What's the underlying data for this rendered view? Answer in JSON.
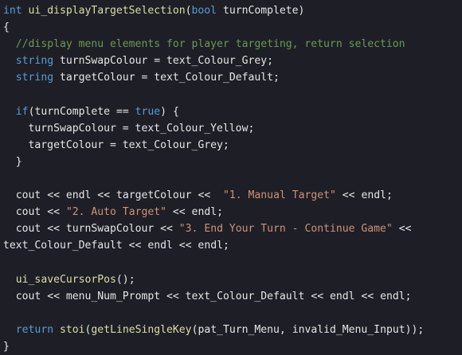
{
  "theme": {
    "background": "#1e1f26",
    "colors": {
      "kw": "#569cd6",
      "fn": "#dcdcaa",
      "id": "#e6e6e6",
      "cm": "#6a9955",
      "st": "#ce9178",
      "op": "#e6e6e6"
    }
  },
  "code_lines": [
    [
      [
        "kw",
        "int"
      ],
      [
        "id",
        " "
      ],
      [
        "fn",
        "ui_displayTargetSelection"
      ],
      [
        "op",
        "("
      ],
      [
        "kw",
        "bool"
      ],
      [
        "id",
        " turnComplete"
      ],
      [
        "op",
        ")"
      ]
    ],
    [
      [
        "op",
        "{"
      ]
    ],
    [
      [
        "id",
        "  "
      ],
      [
        "cm",
        "//display menu elements for player targeting, return selection"
      ]
    ],
    [
      [
        "id",
        "  "
      ],
      [
        "kw",
        "string"
      ],
      [
        "id",
        " turnSwapColour "
      ],
      [
        "op",
        "="
      ],
      [
        "id",
        " text_Colour_Grey"
      ],
      [
        "op",
        ";"
      ]
    ],
    [
      [
        "id",
        "  "
      ],
      [
        "kw",
        "string"
      ],
      [
        "id",
        " targetColour "
      ],
      [
        "op",
        "="
      ],
      [
        "id",
        " text_Colour_Default"
      ],
      [
        "op",
        ";"
      ]
    ],
    [],
    [
      [
        "id",
        "  "
      ],
      [
        "kw",
        "if"
      ],
      [
        "op",
        "("
      ],
      [
        "id",
        "turnComplete "
      ],
      [
        "op",
        "=="
      ],
      [
        "id",
        " "
      ],
      [
        "kw",
        "true"
      ],
      [
        "op",
        ")"
      ],
      [
        "id",
        " "
      ],
      [
        "op",
        "{"
      ]
    ],
    [
      [
        "id",
        "    turnSwapColour "
      ],
      [
        "op",
        "="
      ],
      [
        "id",
        " text_Colour_Yellow"
      ],
      [
        "op",
        ";"
      ]
    ],
    [
      [
        "id",
        "    targetColour "
      ],
      [
        "op",
        "="
      ],
      [
        "id",
        " text_Colour_Grey"
      ],
      [
        "op",
        ";"
      ]
    ],
    [
      [
        "id",
        "  "
      ],
      [
        "op",
        "}"
      ]
    ],
    [],
    [
      [
        "id",
        "  cout "
      ],
      [
        "op",
        "<<"
      ],
      [
        "id",
        " endl "
      ],
      [
        "op",
        "<<"
      ],
      [
        "id",
        " targetColour "
      ],
      [
        "op",
        "<<"
      ],
      [
        "id",
        "  "
      ],
      [
        "st",
        "\"1. Manual Target\""
      ],
      [
        "id",
        " "
      ],
      [
        "op",
        "<<"
      ],
      [
        "id",
        " endl"
      ],
      [
        "op",
        ";"
      ]
    ],
    [
      [
        "id",
        "  cout "
      ],
      [
        "op",
        "<<"
      ],
      [
        "id",
        " "
      ],
      [
        "st",
        "\"2. Auto Target\""
      ],
      [
        "id",
        " "
      ],
      [
        "op",
        "<<"
      ],
      [
        "id",
        " endl"
      ],
      [
        "op",
        ";"
      ]
    ],
    [
      [
        "id",
        "  cout "
      ],
      [
        "op",
        "<<"
      ],
      [
        "id",
        " turnSwapColour "
      ],
      [
        "op",
        "<<"
      ],
      [
        "id",
        " "
      ],
      [
        "st",
        "\"3. End Your Turn - Continue Game\""
      ],
      [
        "id",
        " "
      ],
      [
        "op",
        "<<"
      ]
    ],
    [
      [
        "id",
        "text_Colour_Default "
      ],
      [
        "op",
        "<<"
      ],
      [
        "id",
        " endl "
      ],
      [
        "op",
        "<<"
      ],
      [
        "id",
        " endl"
      ],
      [
        "op",
        ";"
      ]
    ],
    [],
    [
      [
        "id",
        "  "
      ],
      [
        "fn",
        "ui_saveCursorPos"
      ],
      [
        "op",
        "();"
      ]
    ],
    [
      [
        "id",
        "  cout "
      ],
      [
        "op",
        "<<"
      ],
      [
        "id",
        " menu_Num_Prompt "
      ],
      [
        "op",
        "<<"
      ],
      [
        "id",
        " text_Colour_Default "
      ],
      [
        "op",
        "<<"
      ],
      [
        "id",
        " endl "
      ],
      [
        "op",
        "<<"
      ],
      [
        "id",
        " endl"
      ],
      [
        "op",
        ";"
      ]
    ],
    [],
    [
      [
        "id",
        "  "
      ],
      [
        "kw",
        "return"
      ],
      [
        "id",
        " "
      ],
      [
        "fn",
        "stoi"
      ],
      [
        "op",
        "("
      ],
      [
        "fn",
        "getLineSingleKey"
      ],
      [
        "op",
        "("
      ],
      [
        "id",
        "pat_Turn_Menu, invalid_Menu_Input"
      ],
      [
        "op",
        "));"
      ]
    ],
    [
      [
        "op",
        "}"
      ]
    ]
  ]
}
